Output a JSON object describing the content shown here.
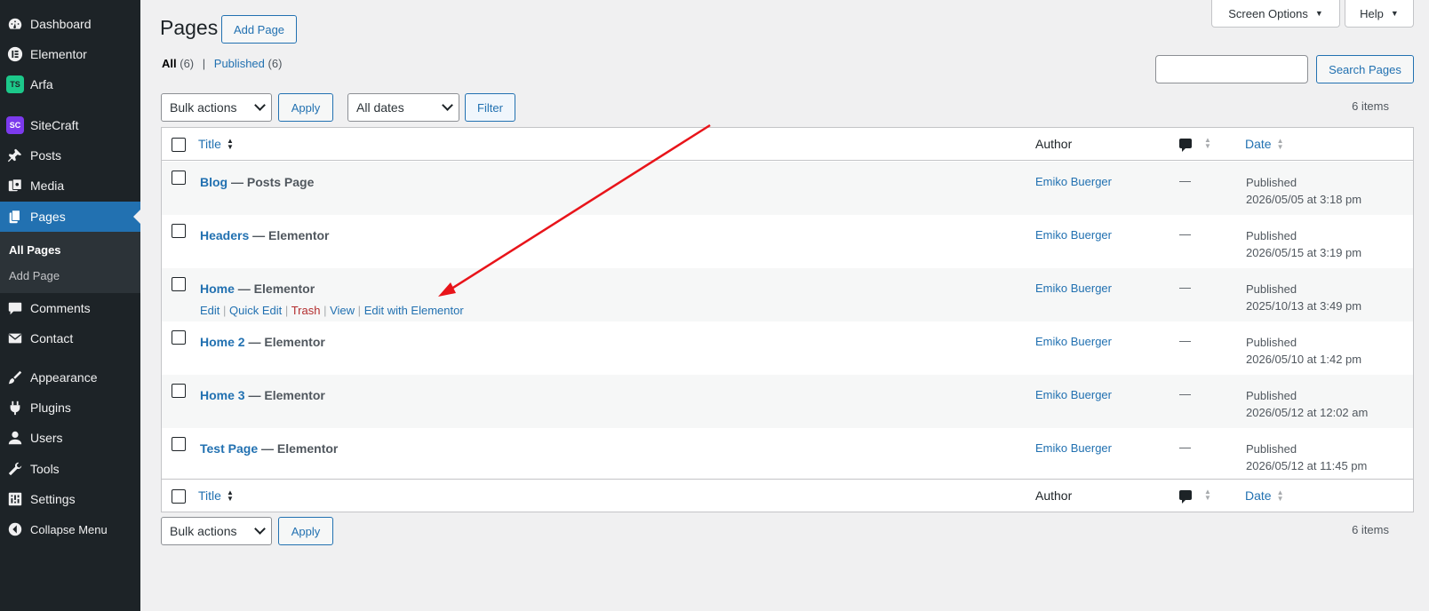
{
  "sidebar": {
    "items": [
      {
        "label": "Dashboard",
        "icon": "dashboard-icon"
      },
      {
        "label": "Elementor",
        "icon": "elementor-icon"
      },
      {
        "label": "Arfa",
        "icon": "arfa-icon"
      },
      {
        "label": "SiteCraft",
        "icon": "sitecraft-icon"
      },
      {
        "label": "Posts",
        "icon": "pin-icon"
      },
      {
        "label": "Media",
        "icon": "media-icon"
      },
      {
        "label": "Pages",
        "icon": "pages-icon"
      },
      {
        "label": "Comments",
        "icon": "comment-icon"
      },
      {
        "label": "Contact",
        "icon": "mail-icon"
      },
      {
        "label": "Appearance",
        "icon": "brush-icon"
      },
      {
        "label": "Plugins",
        "icon": "plug-icon"
      },
      {
        "label": "Users",
        "icon": "user-icon"
      },
      {
        "label": "Tools",
        "icon": "wrench-icon"
      },
      {
        "label": "Settings",
        "icon": "settings-icon"
      },
      {
        "label": "Collapse Menu",
        "icon": "collapse-icon"
      }
    ],
    "submenu": [
      "All Pages",
      "Add Page"
    ],
    "arfa_badge": "TS",
    "sitecraft_badge": "SC"
  },
  "screen_options": "Screen Options",
  "help": "Help",
  "heading": "Pages",
  "add_page": "Add Page",
  "views": {
    "all": "All",
    "all_count": "(6)",
    "separator": "|",
    "published": "Published",
    "published_count": "(6)"
  },
  "search": {
    "value": "",
    "button": "Search Pages"
  },
  "bulk_actions": "Bulk actions",
  "apply": "Apply",
  "dates": "All dates",
  "filter": "Filter",
  "items_count": "6 items",
  "columns": {
    "title": "Title",
    "author": "Author",
    "date": "Date"
  },
  "rows": [
    {
      "title": "Blog",
      "state": " — Posts Page",
      "author": "Emiko Buerger",
      "comments": "—",
      "status": "Published",
      "date": "2026/05/05 at 3:18 pm"
    },
    {
      "title": "Headers",
      "state": " — Elementor",
      "author": "Emiko Buerger",
      "comments": "—",
      "status": "Published",
      "date": "2026/05/15 at 3:19 pm"
    },
    {
      "title": "Home",
      "state": " — Elementor",
      "author": "Emiko Buerger",
      "comments": "—",
      "status": "Published",
      "date": "2025/10/13 at 3:49 pm"
    },
    {
      "title": "Home 2",
      "state": " — Elementor",
      "author": "Emiko Buerger",
      "comments": "—",
      "status": "Published",
      "date": "2026/05/10 at 1:42 pm"
    },
    {
      "title": "Home 3",
      "state": " — Elementor",
      "author": "Emiko Buerger",
      "comments": "—",
      "status": "Published",
      "date": "2026/05/12 at 12:02 am"
    },
    {
      "title": "Test Page",
      "state": " — Elementor",
      "author": "Emiko Buerger",
      "comments": "—",
      "status": "Published",
      "date": "2026/05/12 at 11:45 pm"
    }
  ],
  "row_actions": {
    "edit": "Edit",
    "quick_edit": "Quick Edit",
    "trash": "Trash",
    "view": "View",
    "edit_elementor": "Edit with Elementor",
    "sep": "|"
  },
  "colors": {
    "accent": "#2271b1",
    "sidebar": "#1d2327",
    "active": "#2271b1",
    "trash": "#b32d2e",
    "annotation_arrow": "#e8141a"
  }
}
